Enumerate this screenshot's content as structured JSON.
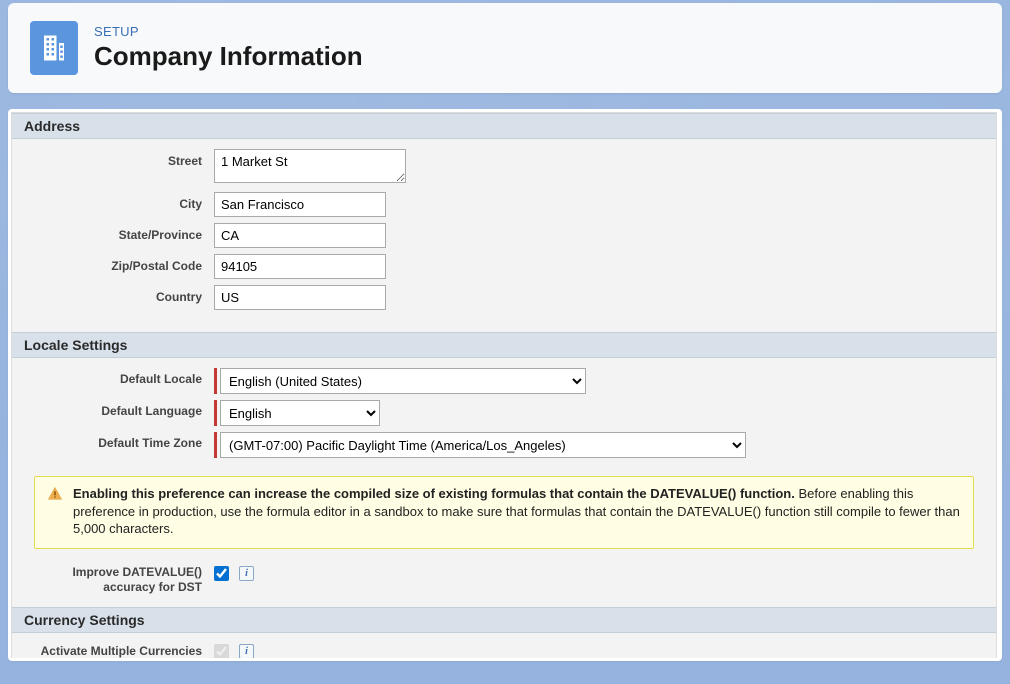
{
  "header": {
    "breadcrumb": "SETUP",
    "title": "Company Information"
  },
  "sections": {
    "address": {
      "heading": "Address",
      "street_label": "Street",
      "street_value": "1 Market St",
      "city_label": "City",
      "city_value": "San Francisco",
      "state_label": "State/Province",
      "state_value": "CA",
      "zip_label": "Zip/Postal Code",
      "zip_value": "94105",
      "country_label": "Country",
      "country_value": "US"
    },
    "locale": {
      "heading": "Locale Settings",
      "default_locale_label": "Default Locale",
      "default_locale_value": "English (United States)",
      "default_language_label": "Default Language",
      "default_language_value": "English",
      "default_timezone_label": "Default Time Zone",
      "default_timezone_value": "(GMT-07:00) Pacific Daylight Time (America/Los_Angeles)",
      "warning_bold": "Enabling this preference can increase the compiled size of existing formulas that contain the DATEVALUE() function.",
      "warning_rest": "Before enabling this preference in production, use the formula editor in a sandbox to make sure that formulas that contain the DATEVALUE() function still compile to fewer than 5,000 characters.",
      "improve_dv_label_line1": "Improve DATEVALUE()",
      "improve_dv_label_line2": "accuracy for DST",
      "improve_dv_checked": true
    },
    "currency": {
      "heading": "Currency Settings",
      "activate_multi_label": "Activate Multiple Currencies",
      "activate_multi_checked": true,
      "activate_multi_disabled": true
    }
  },
  "icons": {
    "info_glyph": "i"
  }
}
